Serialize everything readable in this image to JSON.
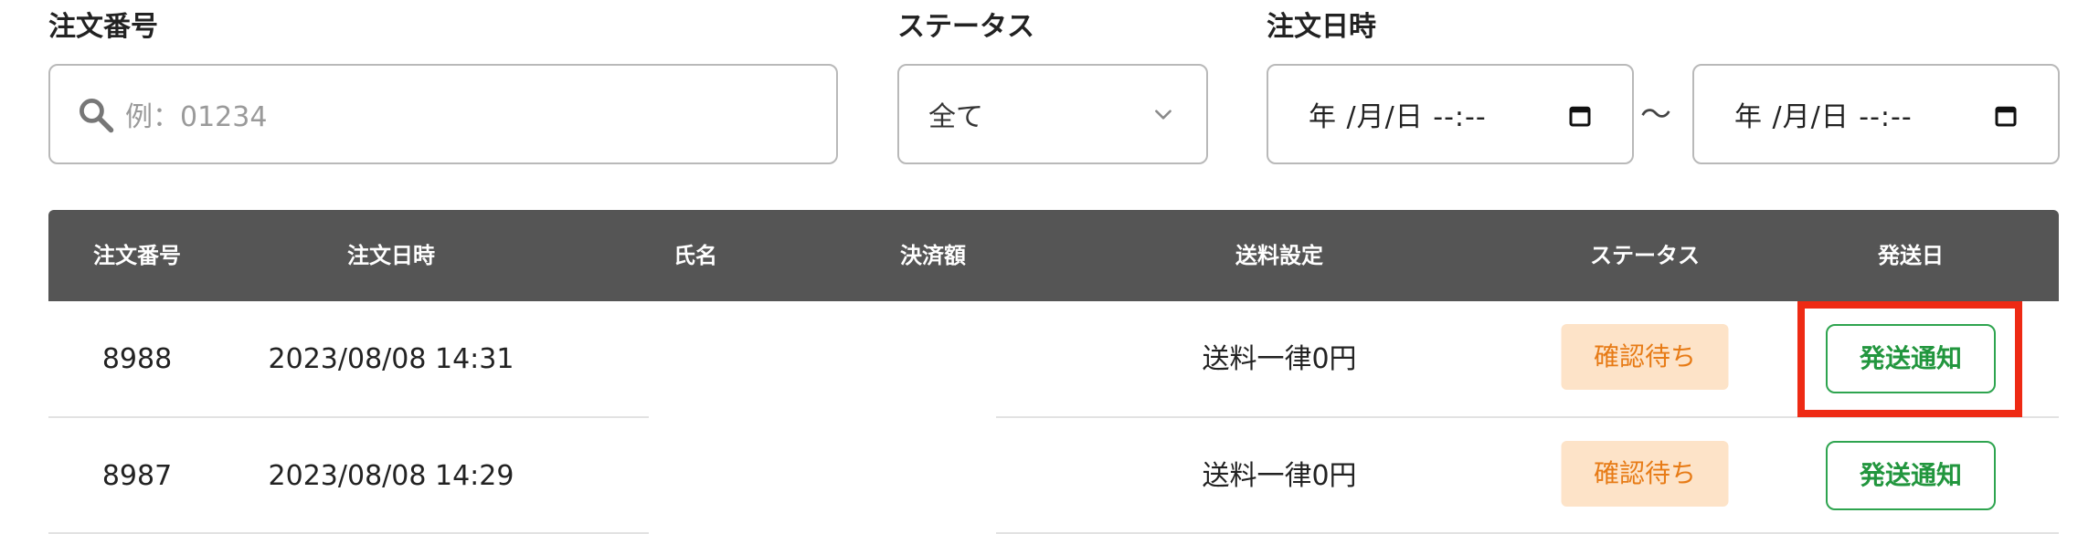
{
  "filters": {
    "order_number": {
      "label": "注文番号",
      "placeholder": "例：01234"
    },
    "status": {
      "label": "ステータス",
      "selected": "全て"
    },
    "order_datetime": {
      "label": "注文日時",
      "from_value": "年 /月/日 --:--",
      "to_value": "年 /月/日 --:--",
      "separator": "〜"
    }
  },
  "table": {
    "columns": [
      "注文番号",
      "注文日時",
      "氏名",
      "決済額",
      "送料設定",
      "ステータス",
      "発送日"
    ],
    "rows": [
      {
        "order_no": "8988",
        "datetime": "2023/08/08 14:31",
        "name": "",
        "amount": "",
        "shipping": "送料一律0円",
        "status": "確認待ち",
        "action": "発送通知"
      },
      {
        "order_no": "8987",
        "datetime": "2023/08/08 14:29",
        "name": "",
        "amount": "",
        "shipping": "送料一律0円",
        "status": "確認待ち",
        "action": "発送通知"
      }
    ]
  },
  "colors": {
    "header_bg": "#555555",
    "badge_bg": "#fde3c8",
    "badge_text": "#e77b16",
    "notify_border": "#2ea44f",
    "highlight": "#ee2a14"
  },
  "icons": {
    "search": "search-icon",
    "dropdown": "chevron-down-icon",
    "calendar": "calendar-icon"
  }
}
